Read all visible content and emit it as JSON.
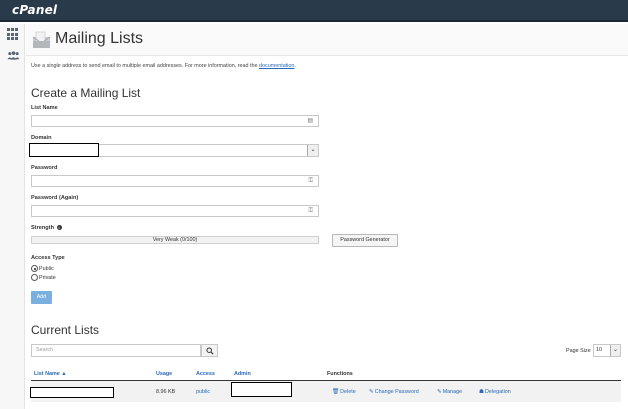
{
  "topbar": {
    "logo": "cPanel"
  },
  "sidebar": {
    "items": [
      {
        "icon": "grid-icon"
      },
      {
        "icon": "users-icon"
      }
    ]
  },
  "header": {
    "title": "Mailing Lists",
    "icon": "mailing-list-icon"
  },
  "intro": {
    "text": "Use a single address to send email to multiple email addresses. For more information, read the ",
    "link_text": "documentation",
    "suffix": "."
  },
  "create": {
    "title": "Create a Mailing List",
    "list_name_label": "List Name",
    "domain_label": "Domain",
    "password_label": "Password",
    "password_again_label": "Password (Again)",
    "strength_label": "Strength",
    "strength_value": "Very Weak (0/100)",
    "strength_percent": 0,
    "password_generator_label": "Password Generator",
    "access_type_label": "Access Type",
    "access_options": [
      "Public",
      "Private"
    ],
    "access_selected": "Public",
    "add_label": "Add"
  },
  "current": {
    "title": "Current Lists",
    "search_placeholder": "Search",
    "page_size_label": "Page Size",
    "page_size_value": "10",
    "columns": {
      "list_name": "List Name ▲",
      "usage": "Usage",
      "access": "Access",
      "admin": "Admin",
      "functions": "Functions"
    },
    "rows": [
      {
        "usage": "8.96 KB",
        "access": "public",
        "functions": {
          "delete": "Delete",
          "change_password": "Change Password",
          "manage": "Manage",
          "delegation": "Delegation"
        }
      }
    ]
  }
}
